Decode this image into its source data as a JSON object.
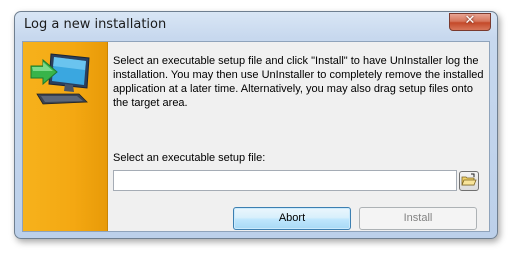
{
  "window": {
    "title": "Log a new installation",
    "close_symbol": "✕"
  },
  "side_panel": {
    "icon": "install-computer-arrow-icon",
    "color": "#f4a812"
  },
  "description": "Select an executable setup file and click \"Install\" to have UnInstaller log the installation. You may then use UnInstaller to completely remove the installed application at a later time. Alternatively, you may also drag setup files onto the target area.",
  "file_select": {
    "label": "Select an executable setup file:",
    "value": "",
    "placeholder": "",
    "browse_icon": "folder-open-icon"
  },
  "buttons": {
    "abort": "Abort",
    "install": "Install"
  }
}
